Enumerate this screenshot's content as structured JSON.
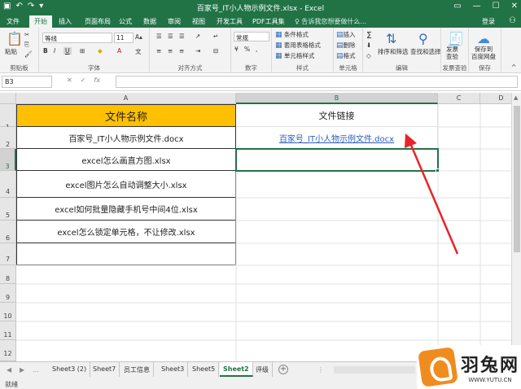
{
  "window": {
    "title": "百家号_IT小人物示例文件.xlsx - Excel",
    "qat_icons": [
      "save-icon",
      "undo-icon",
      "redo-icon",
      "customize-icon"
    ]
  },
  "tabs": [
    {
      "label": "文件"
    },
    {
      "label": "开始"
    },
    {
      "label": "插入"
    },
    {
      "label": "页面布局"
    },
    {
      "label": "公式"
    },
    {
      "label": "数据"
    },
    {
      "label": "审阅"
    },
    {
      "label": "视图"
    },
    {
      "label": "开发工具"
    },
    {
      "label": "PDF工具集"
    }
  ],
  "active_tab_index": 1,
  "tell_me": "告诉我您想要做什么...",
  "login_label": "登录",
  "ribbon": {
    "clipboard": {
      "paste": "粘贴",
      "label": "剪贴板"
    },
    "font": {
      "name": "等线",
      "size": "11",
      "bold": "B",
      "italic": "I",
      "underline": "U",
      "label": "字体"
    },
    "alignment": {
      "label": "对齐方式"
    },
    "number": {
      "format": "常规",
      "label": "数字"
    },
    "styles": {
      "conditional": "条件格式",
      "table": "套用表格格式",
      "cell": "单元格样式",
      "label": "样式"
    },
    "cells": {
      "insert": "插入",
      "delete": "删除",
      "format": "格式",
      "label": "单元格"
    },
    "editing": {
      "sort": "排序和筛选",
      "find": "查找和选择",
      "label": "编辑"
    },
    "invoice": {
      "check": "发票\n查验",
      "label": "发票查验"
    },
    "save": {
      "label": "保存到\n百度网盘",
      "group": "保存"
    }
  },
  "name_box": "B3",
  "fx_label": "fx",
  "columns": [
    "A",
    "B",
    "C",
    "D"
  ],
  "rows": [
    "1",
    "2",
    "3",
    "4",
    "5",
    "6",
    "7",
    "8",
    "9",
    "10",
    "11",
    "12"
  ],
  "table": {
    "header_a": "文件名称",
    "header_b": "文件链接",
    "a": [
      "百家号_IT小人物示例文件.docx",
      "excel怎么画直方图.xlsx",
      "excel图片怎么自动调整大小.xlsx",
      "excel如何批量隐藏手机号中间4位.xlsx",
      "excel怎么锁定单元格，不让修改.xlsx"
    ],
    "b2": "百家号_IT小人物示例文件.docx"
  },
  "sheets": [
    "Sheet3 (2)",
    "Sheet7",
    "员工信息",
    "Sheet3",
    "Sheet5",
    "Sheet2",
    "评级"
  ],
  "active_sheet": "Sheet2",
  "status": "就绪",
  "watermark": {
    "name": "羽兔网",
    "url": "WWW.YUTU.CN"
  },
  "colors": {
    "excel_green": "#217346",
    "header_fill": "#ffc000",
    "link": "#2e5fb8",
    "arrow": "#e8232a"
  }
}
